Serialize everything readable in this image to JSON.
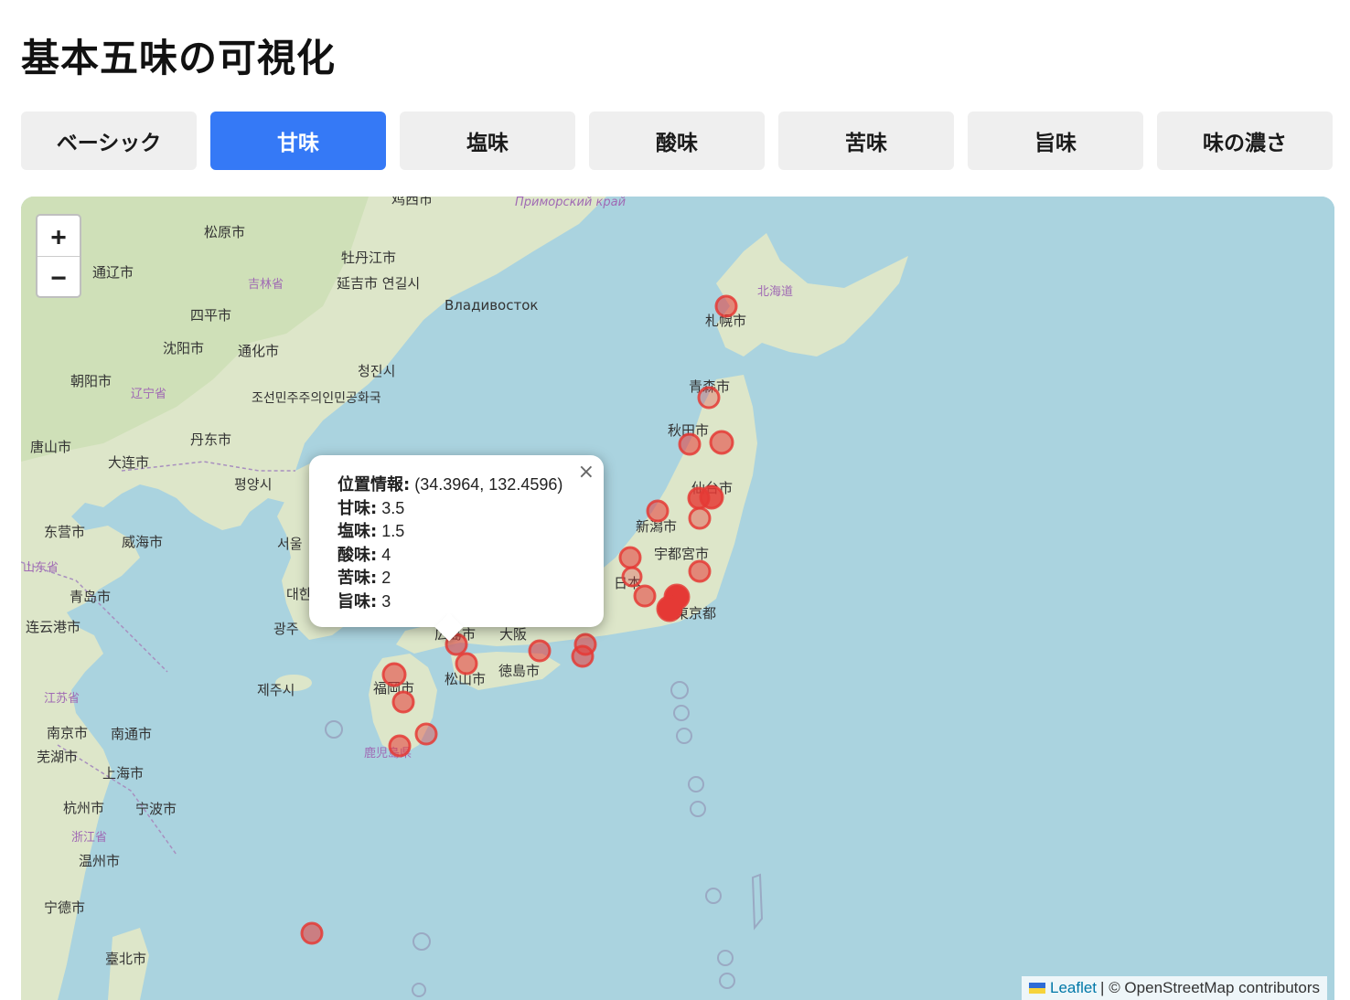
{
  "page": {
    "title": "基本五味の可視化"
  },
  "tabs": [
    {
      "label": "ベーシック",
      "active": false
    },
    {
      "label": "甘味",
      "active": true
    },
    {
      "label": "塩味",
      "active": false
    },
    {
      "label": "酸味",
      "active": false
    },
    {
      "label": "苦味",
      "active": false
    },
    {
      "label": "旨味",
      "active": false
    },
    {
      "label": "味の濃さ",
      "active": false
    }
  ],
  "map": {
    "zoom_in": "+",
    "zoom_out": "−",
    "attribution": {
      "leaflet": "Leaflet",
      "separator": "|",
      "osm": "© OpenStreetMap contributors"
    },
    "marker_color": "#e53935",
    "labels": [
      "松原市",
      "通辽市",
      "吉林省",
      "牡丹江市",
      "延吉市 연길시",
      "Владивосток",
      "Приморский край",
      "四平市",
      "沈阳市",
      "通化市",
      "朝阳市",
      "辽宁省",
      "청진시",
      "조선민주주의인민공화국",
      "丹东市",
      "唐山市",
      "大连市",
      "평양시",
      "东营市",
      "威海市",
      "山东省",
      "青岛市",
      "连云港市",
      "서울",
      "대한",
      "광주",
      "제주시",
      "江苏省",
      "南京市",
      "南通市",
      "芜湖市",
      "上海市",
      "杭州市",
      "宁波市",
      "浙江省",
      "温州市",
      "宁德市",
      "臺北市",
      "福岡市",
      "鹿児島県",
      "松山市",
      "徳島市",
      "大阪",
      "広島市",
      "新潟市",
      "宇都宮市",
      "日本",
      "仙台市",
      "秋田市",
      "青森市",
      "札幌市",
      "北海道",
      "東京都",
      "鸡西市"
    ]
  },
  "popup": {
    "close_icon": "×",
    "location_label": "位置情報:",
    "location_value": "(34.3964, 132.4596)",
    "sweet_label": "甘味:",
    "sweet_value": "3.5",
    "salty_label": "塩味:",
    "salty_value": "1.5",
    "sour_label": "酸味:",
    "sour_value": "4",
    "bitter_label": "苦味:",
    "bitter_value": "2",
    "umami_label": "旨味:",
    "umami_value": "3"
  }
}
